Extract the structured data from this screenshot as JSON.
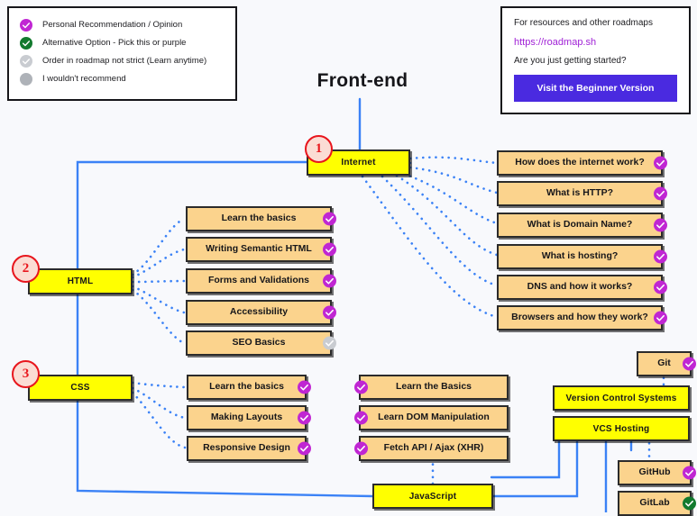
{
  "title": "Front-end",
  "colors": {
    "background": "#f8f9fc",
    "primary_node": "#ffff00",
    "topic_node": "#fbd38d",
    "edge": "#3b82f6",
    "badge_red": "#e8161d",
    "purple": "#c026d3",
    "green": "#127a2e",
    "grey": "#c9ccd1",
    "link": "#a021d6",
    "button": "#4a2ae0"
  },
  "legend": {
    "items": [
      {
        "icon": "check-circle-icon",
        "color": "purple",
        "label": "Personal Recommendation / Opinion"
      },
      {
        "icon": "check-circle-icon",
        "color": "green",
        "label": "Alternative Option - Pick this or purple"
      },
      {
        "icon": "check-circle-icon",
        "color": "grey",
        "label": "Order in roadmap not strict (Learn anytime)"
      },
      {
        "icon": "filled-circle-icon",
        "color": "solid-grey",
        "label": "I wouldn't recommend"
      }
    ]
  },
  "resources": {
    "intro": "For resources and other roadmaps",
    "link": "https://roadmap.sh",
    "question": "Are you just getting started?",
    "button_label": "Visit the Beginner Version"
  },
  "order_badges": [
    {
      "number": "1",
      "for": "Internet"
    },
    {
      "number": "2",
      "for": "HTML"
    },
    {
      "number": "3",
      "for": "CSS"
    }
  ],
  "nodes": {
    "internet": {
      "label": "Internet",
      "kind": "primary"
    },
    "html": {
      "label": "HTML",
      "kind": "primary"
    },
    "css": {
      "label": "CSS",
      "kind": "primary"
    },
    "javascript": {
      "label": "JavaScript",
      "kind": "primary"
    },
    "version_control": {
      "label": "Version Control Systems",
      "kind": "primary"
    },
    "vcs_hosting": {
      "label": "VCS Hosting",
      "kind": "primary"
    }
  },
  "internet_topics": [
    {
      "label": "How does the internet work?",
      "check": "purple"
    },
    {
      "label": "What is HTTP?",
      "check": "purple"
    },
    {
      "label": "What is Domain Name?",
      "check": "purple"
    },
    {
      "label": "What is hosting?",
      "check": "purple"
    },
    {
      "label": "DNS and how it works?",
      "check": "purple"
    },
    {
      "label": "Browsers and how they work?",
      "check": "purple"
    }
  ],
  "html_topics": [
    {
      "label": "Learn the basics",
      "check": "purple"
    },
    {
      "label": "Writing Semantic HTML",
      "check": "purple"
    },
    {
      "label": "Forms and Validations",
      "check": "purple"
    },
    {
      "label": "Accessibility",
      "check": "purple"
    },
    {
      "label": "SEO Basics",
      "check": "grey"
    }
  ],
  "css_topics": [
    {
      "label": "Learn the basics",
      "check": "purple"
    },
    {
      "label": "Making Layouts",
      "check": "purple"
    },
    {
      "label": "Responsive Design",
      "check": "purple"
    }
  ],
  "javascript_topics": [
    {
      "label": "Learn the Basics",
      "check": "purple"
    },
    {
      "label": "Learn DOM Manipulation",
      "check": "purple"
    },
    {
      "label": "Fetch API / Ajax (XHR)",
      "check": "purple"
    }
  ],
  "vcs_topics": [
    {
      "label": "Git",
      "check": "purple"
    }
  ],
  "vcs_hosting_topics": [
    {
      "label": "GitHub",
      "check": "purple"
    },
    {
      "label": "GitLab",
      "check": "green"
    }
  ]
}
